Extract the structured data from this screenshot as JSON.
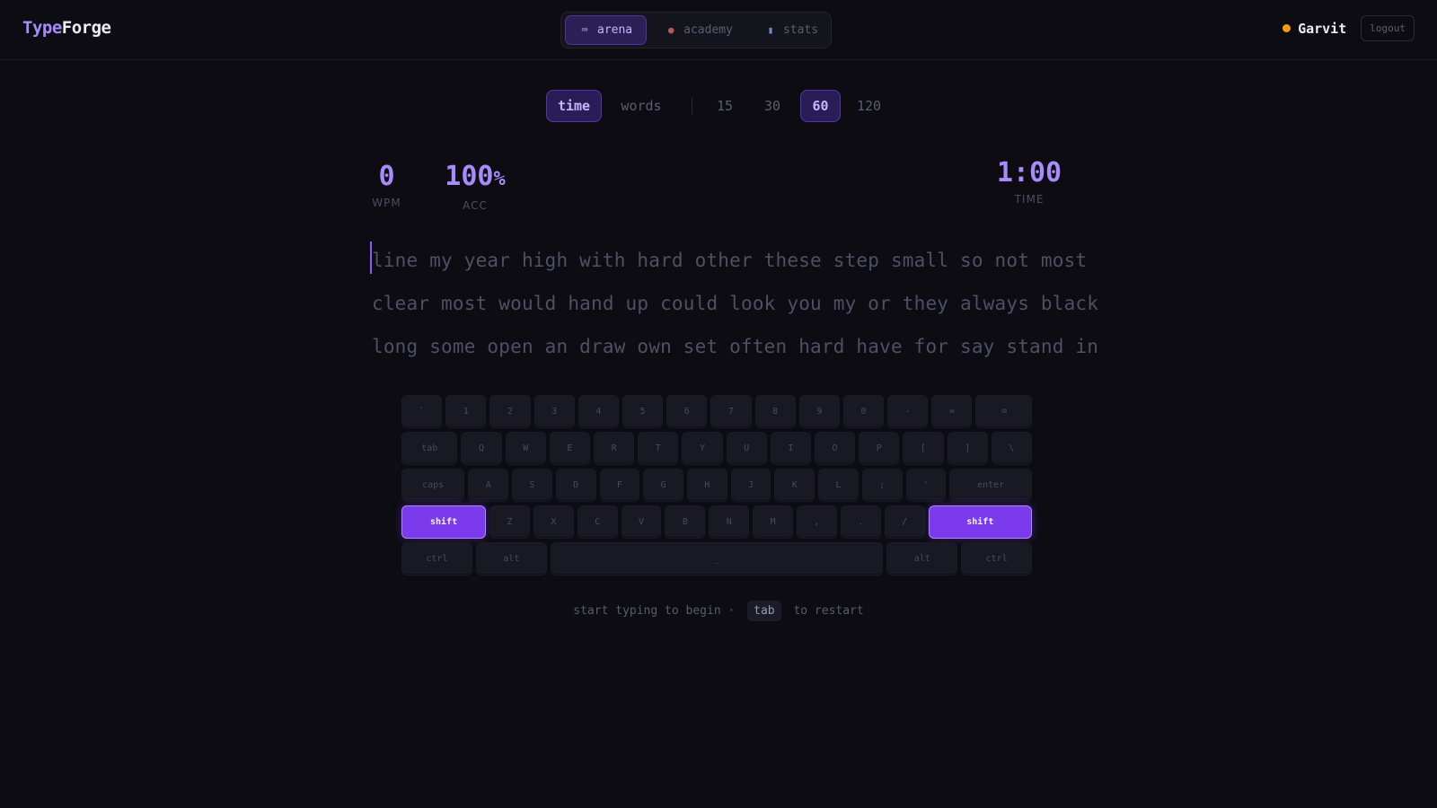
{
  "app": {
    "logo_part1": "Type",
    "logo_part2": "Forge"
  },
  "nav": {
    "tabs": [
      {
        "label": "arena",
        "icon": "⌨"
      },
      {
        "label": "academy",
        "icon": "●"
      },
      {
        "label": "stats",
        "icon": "▮"
      }
    ]
  },
  "user": {
    "name": "Garvit",
    "logout": "logout",
    "status_color": "#f59e0b"
  },
  "modes": {
    "time": "time",
    "words": "words",
    "durations": [
      "15",
      "30",
      "60",
      "120"
    ],
    "selected": "60"
  },
  "stats": {
    "wpm": "0",
    "wpm_label": "WPM",
    "acc": "100",
    "acc_unit": "%",
    "acc_label": "ACC",
    "timer": "1:00",
    "timer_label": "TIME"
  },
  "text_lines": [
    "line my year high with hard other these step small so not most",
    "clear most would hand up could look you my or they always black",
    "long some open an draw own set often hard have for say stand in"
  ],
  "keyboard": {
    "row1": [
      "`",
      "1",
      "2",
      "3",
      "4",
      "5",
      "6",
      "7",
      "8",
      "9",
      "0",
      "-",
      "=",
      "⌫"
    ],
    "row2": [
      "tab",
      "Q",
      "W",
      "E",
      "R",
      "T",
      "Y",
      "U",
      "I",
      "O",
      "P",
      "[",
      "]",
      "\\"
    ],
    "row3": [
      "caps",
      "A",
      "S",
      "D",
      "F",
      "G",
      "H",
      "J",
      "K",
      "L",
      ";",
      "'",
      "enter"
    ],
    "row4": [
      "shift",
      "Z",
      "X",
      "C",
      "V",
      "B",
      "N",
      "M",
      ",",
      ".",
      "/",
      "shift"
    ],
    "row5": [
      "ctrl",
      "alt",
      "_",
      "alt",
      "ctrl"
    ]
  },
  "hint": {
    "before": "start typing to begin ·",
    "key": "tab",
    "after": "to restart"
  },
  "colors": {
    "accent": "#a78bfa",
    "accent_strong": "#7c3aed",
    "background": "#0c0c12"
  }
}
